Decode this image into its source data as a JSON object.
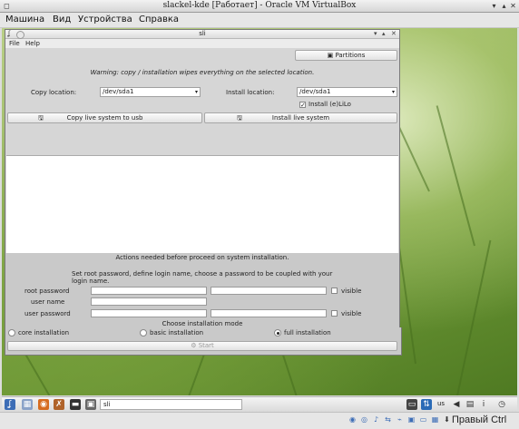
{
  "vbox": {
    "title": "slackel-kde [Работает] - Oracle VM VirtualBox",
    "menus": [
      "Машина",
      "Вид",
      "Устройства",
      "Справка"
    ]
  },
  "sli": {
    "title": "sli",
    "menu": {
      "file": "File",
      "help": "Help"
    },
    "partitions_label": "Partitions",
    "warning": "Warning: copy / installation wipes everything on the selected location.",
    "copy_location_label": "Copy location:",
    "copy_location_value": "/dev/sda1",
    "install_location_label": "Install location:",
    "install_location_value": "/dev/sda1",
    "install_lilo_label": "Install (e)LiLo",
    "copy_usb_label": "Copy live system to usb",
    "install_live_label": "Install live system",
    "actions_needed": "Actions needed before proceed on system installation.",
    "set_root_text": "Set root password, define login name, choose a password to be coupled with your login name.",
    "root_password_label": "root password",
    "user_name_label": "user name",
    "user_password_label": "user password",
    "visible_label": "visible",
    "choose_mode": "Choose installation mode",
    "modes": [
      {
        "label": "core installation",
        "selected": false
      },
      {
        "label": "basic installation",
        "selected": false
      },
      {
        "label": "full installation",
        "selected": true
      }
    ],
    "start_label": "Start"
  },
  "taskbar": {
    "task_label": "sli",
    "keyboard_layout": "us"
  },
  "statusbar": {
    "host_key": "Правый Ctrl"
  },
  "colors": {
    "accent": "#3d6db6"
  }
}
